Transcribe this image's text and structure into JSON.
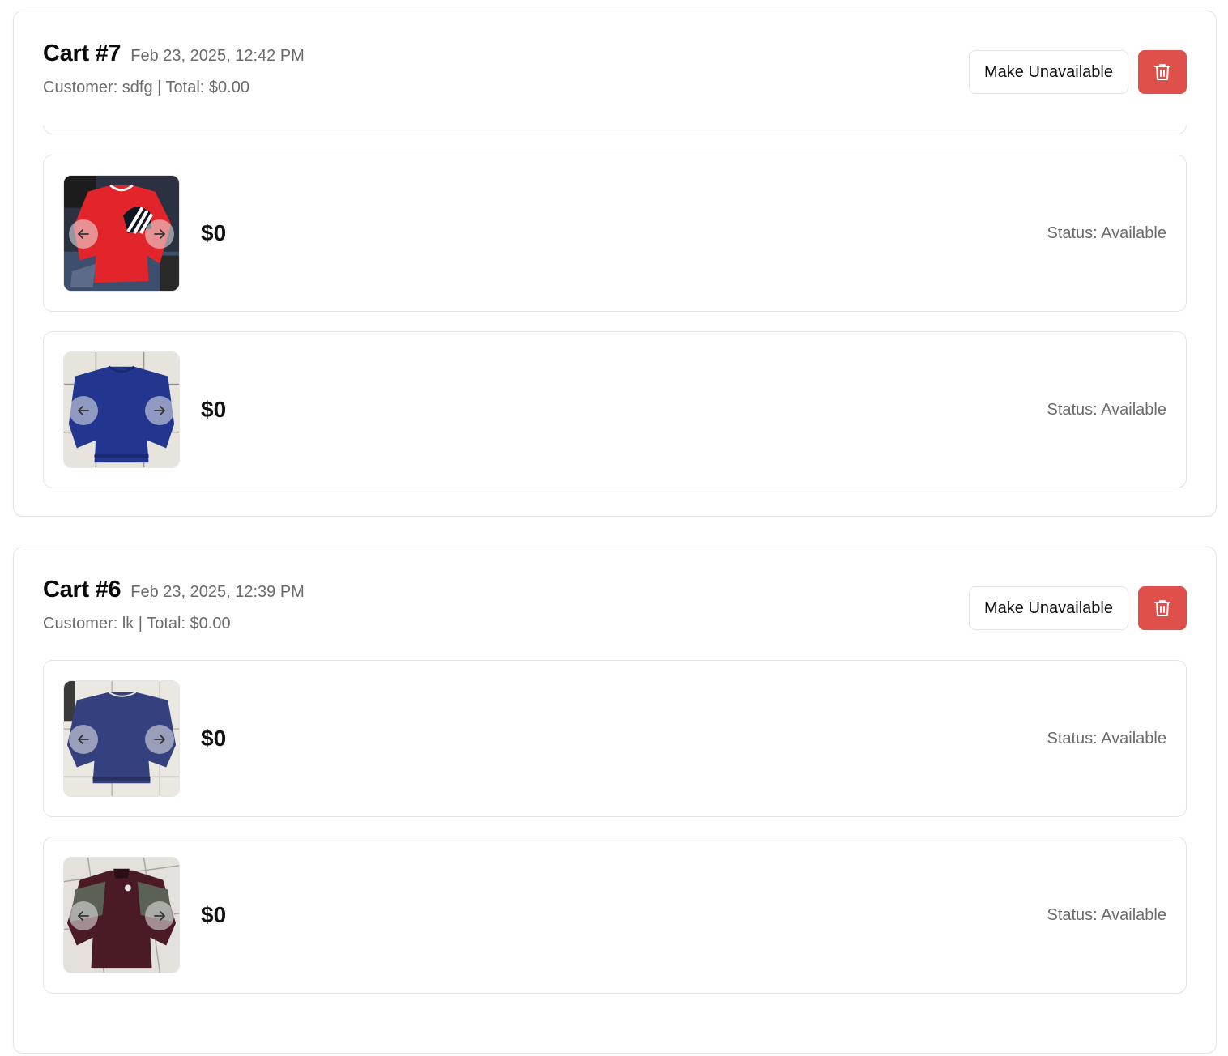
{
  "carts": [
    {
      "title": "Cart #7",
      "date": "Feb 23, 2025, 12:42 PM",
      "meta": "Customer: sdfg | Total: $0.00",
      "make_unavailable_label": "Make Unavailable",
      "items": [
        {
          "price": "$0",
          "status": "Status: Available",
          "image": "red-sweatshirt"
        },
        {
          "price": "$0",
          "status": "Status: Available",
          "image": "blue-sweatshirt"
        }
      ]
    },
    {
      "title": "Cart #6",
      "date": "Feb 23, 2025, 12:39 PM",
      "meta": "Customer: lk | Total: $0.00",
      "make_unavailable_label": "Make Unavailable",
      "items": [
        {
          "price": "$0",
          "status": "Status: Available",
          "image": "navy-sweatshirt"
        },
        {
          "price": "$0",
          "status": "Status: Available",
          "image": "maroon-track-jacket"
        }
      ]
    }
  ],
  "icons": {
    "delete": "trash-icon",
    "prev": "arrow-left-icon",
    "next": "arrow-right-icon"
  },
  "colors": {
    "delete_button": "#e0504a",
    "muted_text": "#6b6b6b",
    "border": "#e4e4e7"
  }
}
